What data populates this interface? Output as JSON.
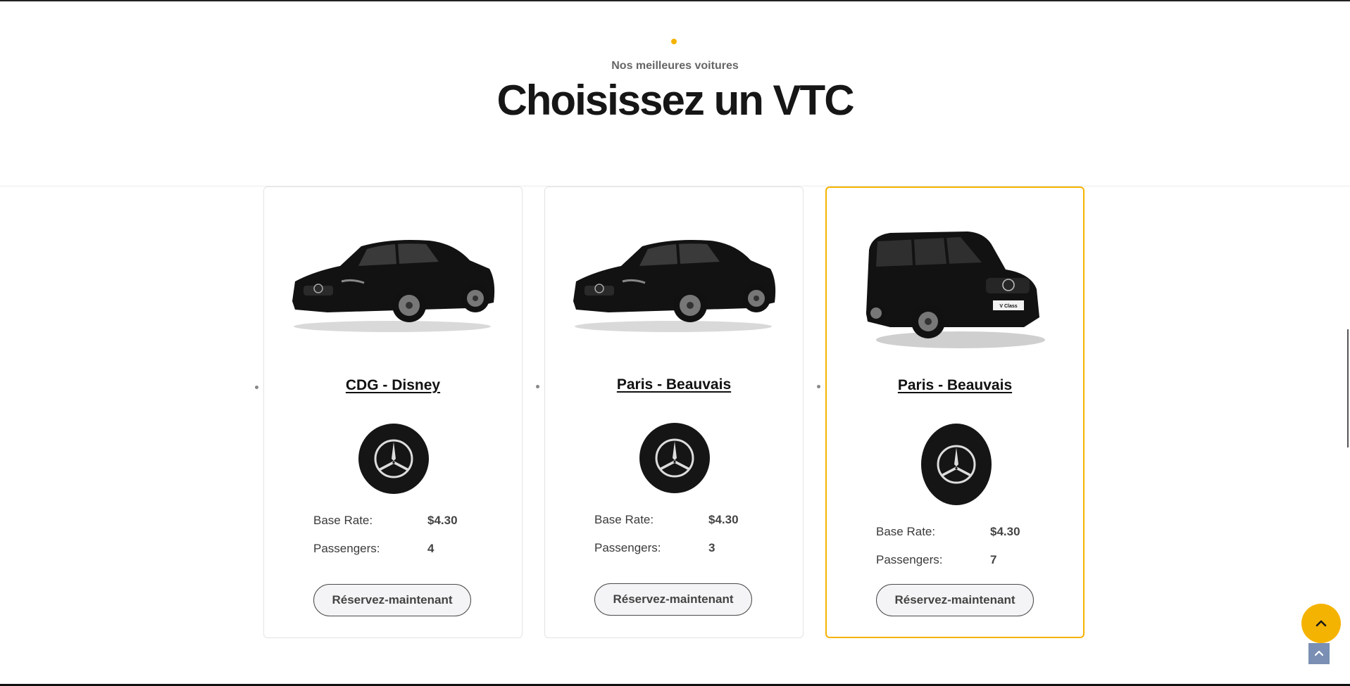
{
  "section": {
    "eyebrow": "Nos meilleures voitures",
    "title": "Choisissez un VTC"
  },
  "theme": {
    "accent": "#f5b301",
    "car_color": "#121212",
    "small_button": "#7a8fb3"
  },
  "labels": {
    "base_rate": "Base Rate:",
    "passengers": "Passengers:",
    "book_button": "Réservez-maintenant"
  },
  "cars": [
    {
      "title": "CDG - Disney",
      "base_rate": "$4.30",
      "passengers": "4",
      "vehicle": "sedan-image",
      "brand": "mercedes-logo-icon"
    },
    {
      "title": "Paris - Beauvais",
      "base_rate": "$4.30",
      "passengers": "3",
      "vehicle": "sedan-image",
      "brand": "mercedes-logo-icon"
    },
    {
      "title": "Paris - Beauvais",
      "base_rate": "$4.30",
      "passengers": "7",
      "vehicle": "van-image",
      "brand": "mercedes-logo-icon",
      "plate_text": "V Class"
    }
  ],
  "icons": {
    "scroll_top": "chevron-up-icon",
    "scroll_top_small": "arrow-up-icon"
  }
}
